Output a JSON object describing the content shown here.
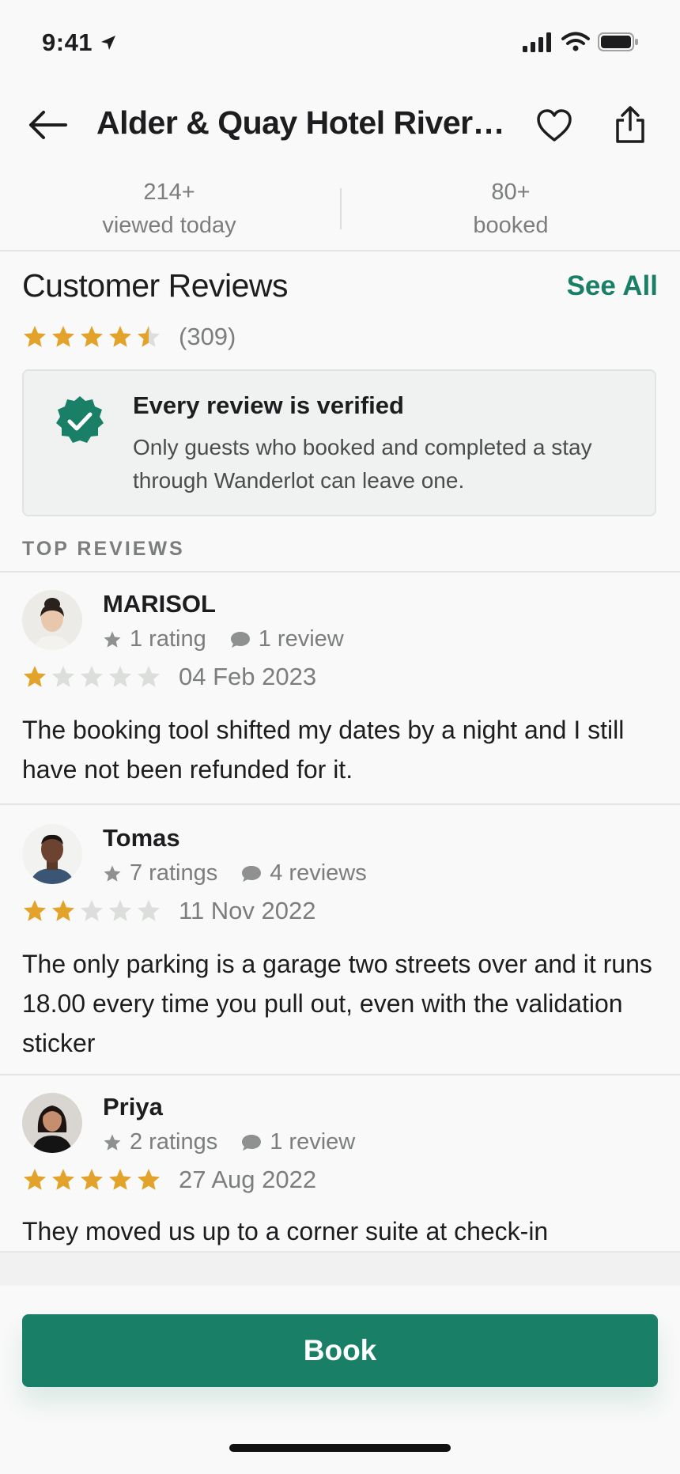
{
  "status_bar": {
    "time": "9:41"
  },
  "header": {
    "title": "Alder & Quay Hotel Riversi..."
  },
  "stats": {
    "viewed_count": "214+",
    "viewed_label": "viewed today",
    "booked_count": "80+",
    "booked_label": "booked"
  },
  "reviews_section": {
    "title": "Customer Reviews",
    "see_all": "See All",
    "overall_rating": 4.5,
    "review_count": "(309)",
    "verified_title": "Every review is verified",
    "verified_text": "Only guests who booked and completed a stay through Wanderlot can leave one.",
    "top_label": "TOP REVIEWS"
  },
  "reviews": [
    {
      "name": "MARISOL",
      "ratings": "1 rating",
      "reviews": "1 review",
      "stars": 1,
      "date": "04 Feb 2023",
      "text": "The booking tool shifted my dates by a night and I still have not been refunded for it."
    },
    {
      "name": "Tomas",
      "ratings": "7 ratings",
      "reviews": "4 reviews",
      "stars": 2,
      "date": "11 Nov 2022",
      "text": "The only parking is a garage two streets over and it runs 18.00 every time you pull out, even with the validation sticker"
    },
    {
      "name": "Priya",
      "ratings": "2 ratings",
      "reviews": "1 review",
      "stars": 5,
      "date": "27 Aug 2022",
      "text": "They moved us up to a corner suite at check-in"
    }
  ],
  "footer": {
    "book_label": "Book"
  },
  "colors": {
    "accent": "#1a7f67",
    "star": "#e3a22a",
    "star_empty": "#dcdedc"
  }
}
